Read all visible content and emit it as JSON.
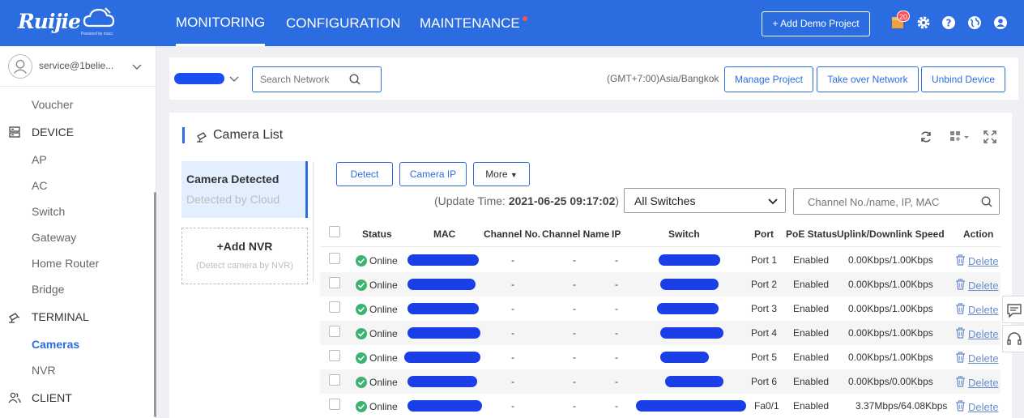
{
  "brand": {
    "name": "Ruijie",
    "tagline": "Powered by macc"
  },
  "top_nav": [
    {
      "label": "MONITORING",
      "active": true
    },
    {
      "label": "CONFIGURATION",
      "active": false
    },
    {
      "label": "MAINTENANCE",
      "active": false,
      "dot": true
    }
  ],
  "header": {
    "demo_button": "+ Add Demo Project",
    "notification_count": "20"
  },
  "sidebar": {
    "account": "service@1belie...",
    "items": [
      {
        "label": "Voucher",
        "type": "sub"
      },
      {
        "label": "DEVICE",
        "type": "group",
        "icon": "server-icon"
      },
      {
        "label": "AP",
        "type": "sub"
      },
      {
        "label": "AC",
        "type": "sub"
      },
      {
        "label": "Switch",
        "type": "sub"
      },
      {
        "label": "Gateway",
        "type": "sub"
      },
      {
        "label": "Home Router",
        "type": "sub"
      },
      {
        "label": "Bridge",
        "type": "sub"
      },
      {
        "label": "TERMINAL",
        "type": "group",
        "icon": "camera-icon"
      },
      {
        "label": "Cameras",
        "type": "sub",
        "active": true
      },
      {
        "label": "NVR",
        "type": "sub"
      },
      {
        "label": "CLIENT",
        "type": "group",
        "icon": "users-icon"
      }
    ]
  },
  "network_bar": {
    "search_placeholder": "Search Network",
    "timezone": "(GMT+7:00)Asia/Bangkok",
    "buttons": [
      "Manage Project",
      "Take over Network",
      "Unbind Device"
    ]
  },
  "panel": {
    "title": "Camera List",
    "tab_title": "Camera Detected",
    "tab_sub": "Detected by Cloud",
    "add_nvr_title": "+Add NVR",
    "add_nvr_sub": "(Detect camera by NVR)",
    "actions": {
      "detect": "Detect",
      "camera_ip": "Camera IP",
      "more": "More"
    },
    "update_prefix": "(Update Time: ",
    "update_time": "2021-06-25 09:17:02",
    "update_suffix": ")",
    "switch_filter": "All Switches",
    "channel_search_placeholder": "Channel No./name, IP, MAC"
  },
  "table": {
    "headers": {
      "status": "Status",
      "mac": "MAC",
      "channel_no": "Channel No.",
      "channel_name": "Channel Name",
      "ip": "IP",
      "switch": "Switch",
      "port": "Port",
      "poe": "PoE Status",
      "speed": "Uplink/Downlink Speed",
      "action": "Action"
    },
    "rows": [
      {
        "status": "Online",
        "channel_no": "-",
        "channel_name": "-",
        "ip": "-",
        "port": "Port 1",
        "poe": "Enabled",
        "speed": "0.00Kbps/1.00Kbps",
        "action": "Delete"
      },
      {
        "status": "Online",
        "channel_no": "-",
        "channel_name": "-",
        "ip": "-",
        "port": "Port 2",
        "poe": "Enabled",
        "speed": "0.00Kbps/1.00Kbps",
        "action": "Delete"
      },
      {
        "status": "Online",
        "channel_no": "-",
        "channel_name": "-",
        "ip": "-",
        "port": "Port 3",
        "poe": "Enabled",
        "speed": "0.00Kbps/1.00Kbps",
        "action": "Delete"
      },
      {
        "status": "Online",
        "channel_no": "-",
        "channel_name": "-",
        "ip": "-",
        "port": "Port 4",
        "poe": "Enabled",
        "speed": "0.00Kbps/1.00Kbps",
        "action": "Delete"
      },
      {
        "status": "Online",
        "channel_no": "-",
        "channel_name": "-",
        "ip": "-",
        "port": "Port 5",
        "poe": "Enabled",
        "speed": "0.00Kbps/1.00Kbps",
        "action": "Delete"
      },
      {
        "status": "Online",
        "channel_no": "-",
        "channel_name": "-",
        "ip": "-",
        "port": "Port 6",
        "poe": "Enabled",
        "speed": "0.00Kbps/0.00Kbps",
        "action": "Delete"
      },
      {
        "status": "Online",
        "channel_no": "-",
        "channel_name": "-",
        "ip": "-",
        "port": "Fa0/1",
        "poe": "Enabled",
        "speed": "3.37Mbps/64.08Kbps",
        "action": "Delete"
      }
    ]
  },
  "colors": {
    "brand": "#2b6de0",
    "online": "#3cb371",
    "redacted": "#1a3fe6"
  }
}
